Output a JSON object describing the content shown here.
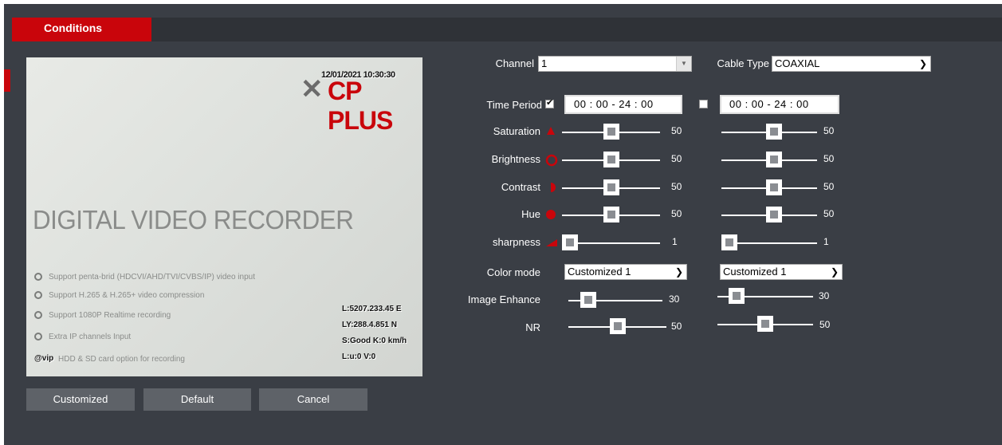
{
  "tabs": [
    {
      "label": "Conditions",
      "active": true
    }
  ],
  "preview": {
    "osd_time": "12/01/2021 10:30:30",
    "logo_text": "CP PLUS",
    "title": "DIGITAL VIDEO RECORDER",
    "features": [
      "Support penta-brid (HDCVI/AHD/TVI/CVBS/IP) video input",
      "Support H.265 & H.265+ video compression",
      "Support 1080P Realtime recording",
      "Extra IP channels Input",
      "HDD & SD card option for recording"
    ],
    "osd_bottom_left": "@vip",
    "osd_bottom_right": [
      "L:5207.233.45 E",
      "LY:288.4.851 N",
      "S:Good K:0 km/h",
      "L:u:0 V:0"
    ]
  },
  "buttons": {
    "customized": "Customized",
    "default": "Default",
    "cancel": "Cancel"
  },
  "form": {
    "channel_label": "Channel",
    "channel_value": "1",
    "cable_type_label": "Cable Type",
    "cable_type_value": "COAXIAL",
    "time_period_label": "Time Period",
    "time_period_1": "00 : 00 - 24 : 00",
    "time_period_2": "00 : 00 - 24 : 00",
    "time_period_1_checked": true,
    "time_period_2_checked": false,
    "sliders": [
      {
        "label": "Saturation",
        "value1": "50",
        "value2": "50",
        "level1": 0.5,
        "level2": 0.5
      },
      {
        "label": "Brightness",
        "value1": "50",
        "value2": "50",
        "level1": 0.5,
        "level2": 0.5
      },
      {
        "label": "Contrast",
        "value1": "50",
        "value2": "50",
        "level1": 0.5,
        "level2": 0.5
      },
      {
        "label": "Hue",
        "value1": "50",
        "value2": "50",
        "level1": 0.5,
        "level2": 0.5
      },
      {
        "label": "sharpness",
        "value1": "1",
        "value2": "1",
        "level1": 0.0,
        "level2": 0.0
      }
    ],
    "color_mode_label": "Color mode",
    "color_mode_1": "Customized 1",
    "color_mode_2": "Customized 1",
    "image_enhance_label": "Image Enhance",
    "image_enhance_value1": "30",
    "image_enhance_value2": "30",
    "image_enhance_level1": 0.3,
    "image_enhance_level2": 0.3,
    "nr_label": "NR",
    "nr_value1": "50",
    "nr_value2": "50",
    "nr_level1": 0.5,
    "nr_level2": 0.5
  },
  "colors": {
    "accent": "#c9050b",
    "panel": "#3a3e45",
    "button": "#5e6268"
  },
  "icons": [
    "saturation-icon",
    "brightness-icon",
    "contrast-icon",
    "hue-icon",
    "sharpness-icon",
    "dropdown-arrow-icon",
    "checkbox-icon"
  ]
}
